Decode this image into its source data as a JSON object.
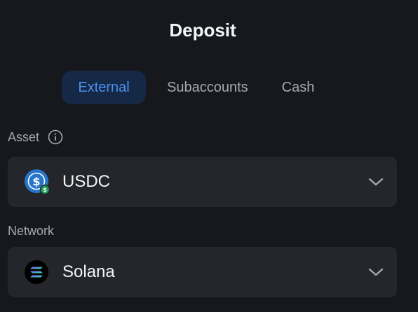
{
  "dialog": {
    "title": "Deposit"
  },
  "tabs": [
    {
      "label": "External",
      "active": true
    },
    {
      "label": "Subaccounts",
      "active": false
    },
    {
      "label": "Cash",
      "active": false
    }
  ],
  "asset": {
    "label": "Asset",
    "info_icon": "info-icon",
    "selected": "USDC",
    "icon": "usdc-icon"
  },
  "network": {
    "label": "Network",
    "selected": "Solana",
    "icon": "solana-icon"
  },
  "colors": {
    "background": "#16181d",
    "field": "#24262c",
    "accent": "#4a90ee",
    "active_tab_bg": "#152846",
    "muted_text": "#a3a9b5"
  }
}
